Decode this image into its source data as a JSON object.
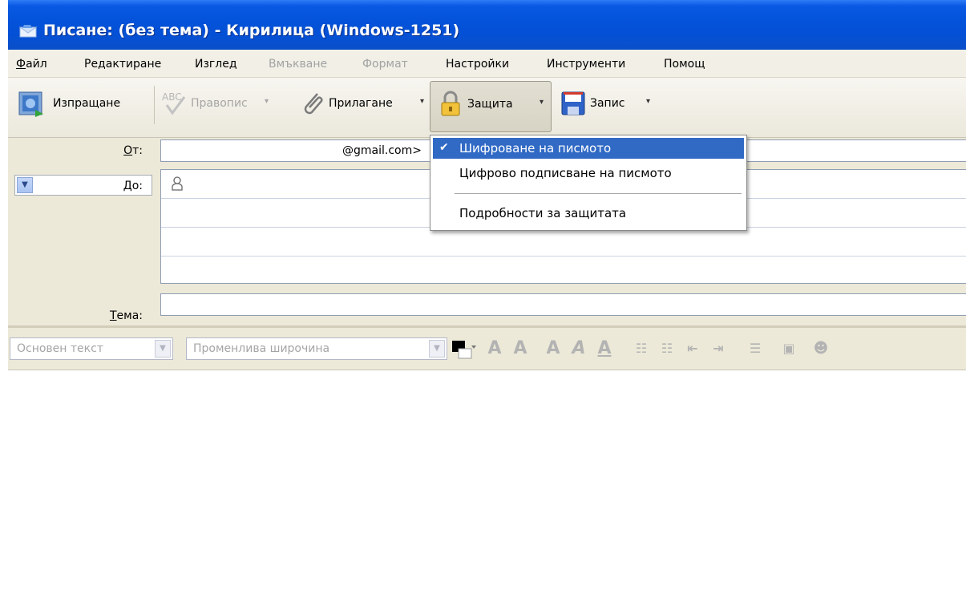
{
  "window": {
    "title": "Писане: (без тема) - Кирилица (Windows-1251)"
  },
  "menubar": {
    "items": [
      {
        "label": "Файл",
        "disabled": false
      },
      {
        "label": "Редактиране",
        "disabled": false
      },
      {
        "label": "Изглед",
        "disabled": false
      },
      {
        "label": "Вмъкване",
        "disabled": true
      },
      {
        "label": "Формат",
        "disabled": true
      },
      {
        "label": "Настройки",
        "disabled": false
      },
      {
        "label": "Инструменти",
        "disabled": false
      },
      {
        "label": "Помощ",
        "disabled": false
      }
    ]
  },
  "toolbar": {
    "send": "Изпращане",
    "spell": "Правопис",
    "attach": "Прилагане",
    "security": "Защита",
    "save": "Запис"
  },
  "header": {
    "from_label": "От:",
    "from_value": "@gmail.com>",
    "to_label": "До:",
    "subject_label": "Тема:",
    "subject_value": ""
  },
  "format_toolbar": {
    "paragraph_style": "Основен текст",
    "font_family": "Променлива широчина"
  },
  "security_menu": {
    "items": [
      {
        "label": "Шифроване на писмото",
        "checked": true,
        "highlighted": true
      },
      {
        "label": "Цифрово подписване на писмото",
        "checked": false,
        "highlighted": false
      },
      {
        "label": "Подробности за защитата",
        "checked": false,
        "highlighted": false
      }
    ]
  },
  "colors": {
    "titlebar": "#0453da",
    "menu_highlight": "#316ac5",
    "window_bg": "#ece9d8"
  }
}
